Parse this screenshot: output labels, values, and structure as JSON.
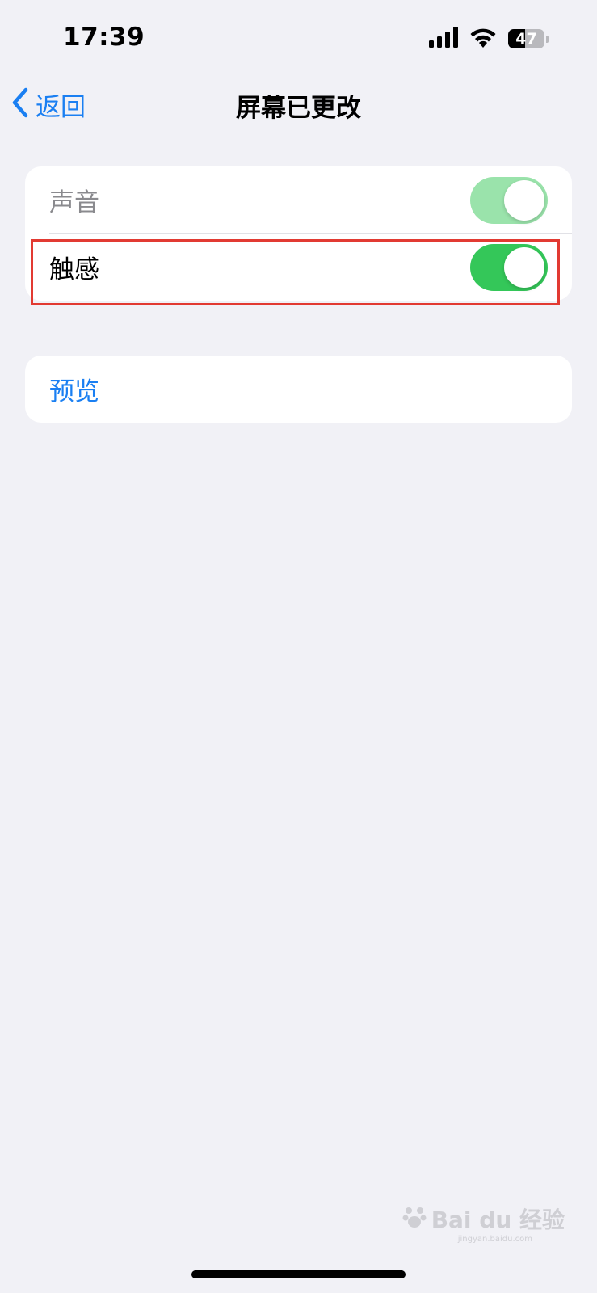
{
  "status_bar": {
    "time": "17:39",
    "battery_level": "47",
    "battery_fraction": 0.47,
    "icons": [
      "cellular-signal-icon",
      "wifi-icon",
      "battery-icon"
    ]
  },
  "nav": {
    "back_label": "返回",
    "title": "屏幕已更改"
  },
  "settings": {
    "rows": [
      {
        "label": "声音",
        "toggle_on": true,
        "disabled": true
      },
      {
        "label": "触感",
        "toggle_on": true,
        "disabled": false
      }
    ],
    "preview_label": "预览"
  },
  "colors": {
    "background": "#f1f1f6",
    "accent_blue": "#1a7ff2",
    "toggle_on": "#34c759",
    "toggle_on_disabled": "#9ae3ab",
    "highlight": "#e23a32"
  },
  "watermark": {
    "text": "Bai du 经验",
    "sub": "jingyan.baidu.com"
  }
}
